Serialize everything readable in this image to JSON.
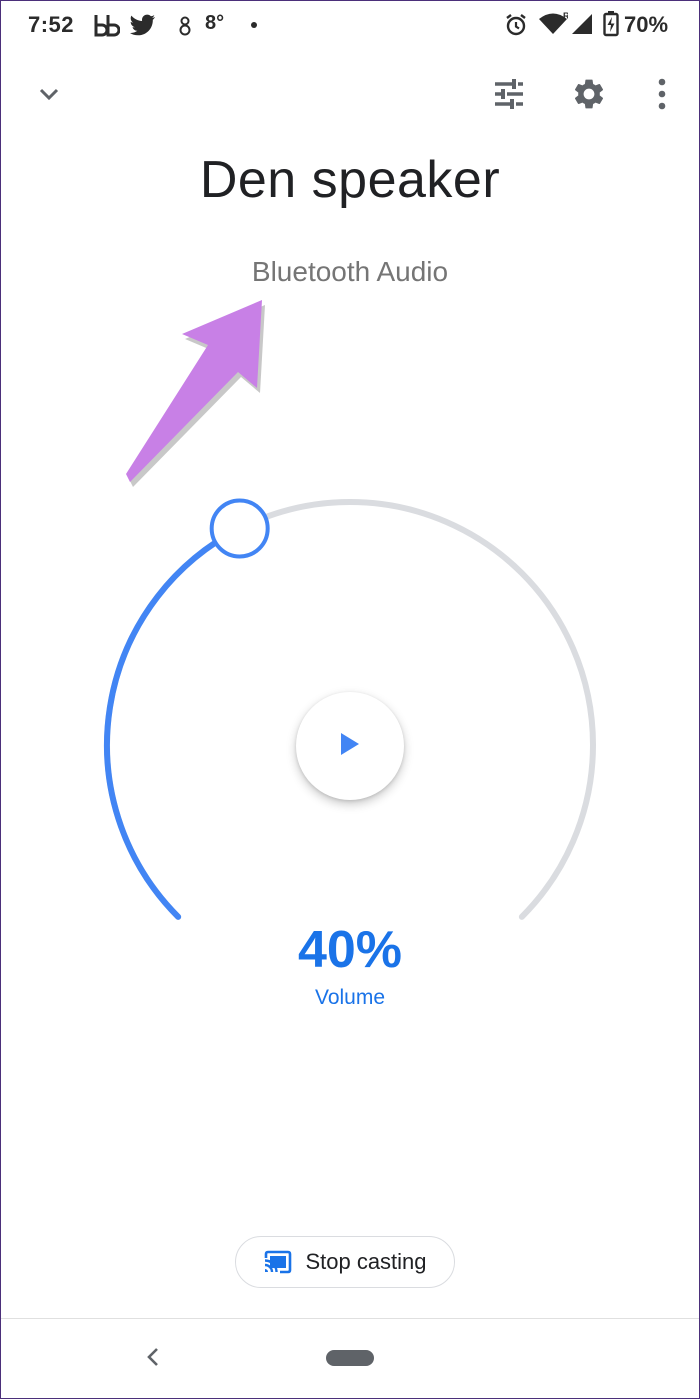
{
  "status_bar": {
    "time": "7:52",
    "temperature": "8°",
    "battery": "70%",
    "icons": [
      "bb-app-icon",
      "twitter-icon",
      "weather-icon",
      "alarm-icon",
      "wifi-icon",
      "signal-icon",
      "battery-icon"
    ]
  },
  "toolbar": {
    "icons": [
      "chevron-down-icon",
      "equalizer-icon",
      "settings-icon",
      "more-vert-icon"
    ]
  },
  "device": {
    "name": "Den speaker",
    "source": "Bluetooth Audio"
  },
  "volume": {
    "value_text": "40%",
    "label": "Volume",
    "level": 0.4
  },
  "playback": {
    "icon": "play-icon"
  },
  "stop_casting": {
    "label": "Stop casting",
    "icon": "cast-icon"
  },
  "nav_bar": {
    "icons": [
      "back-icon",
      "home-pill"
    ]
  },
  "annotation": {
    "icon": "arrow-icon"
  },
  "colors": {
    "accent": "#4285f4",
    "volume_text": "#1a73e8",
    "track": "#dadce0",
    "annotation_arrow": "#c77fe0"
  }
}
